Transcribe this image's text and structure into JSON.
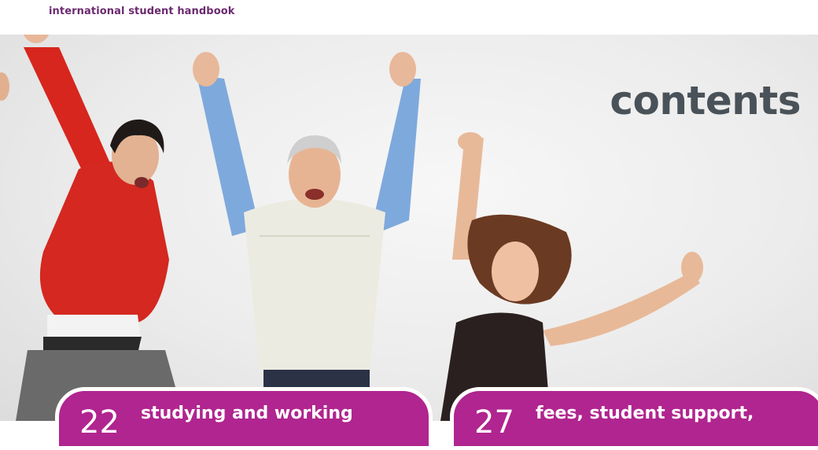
{
  "header": {
    "title": "international student handbook"
  },
  "page": {
    "heading": "contents"
  },
  "toc": [
    {
      "number": "22",
      "label": "studying and working"
    },
    {
      "number": "27",
      "label": "fees, student support,"
    }
  ],
  "colors": {
    "accent": "#b0258f",
    "heading": "#4a5259",
    "brand": "#6b2a6f"
  }
}
